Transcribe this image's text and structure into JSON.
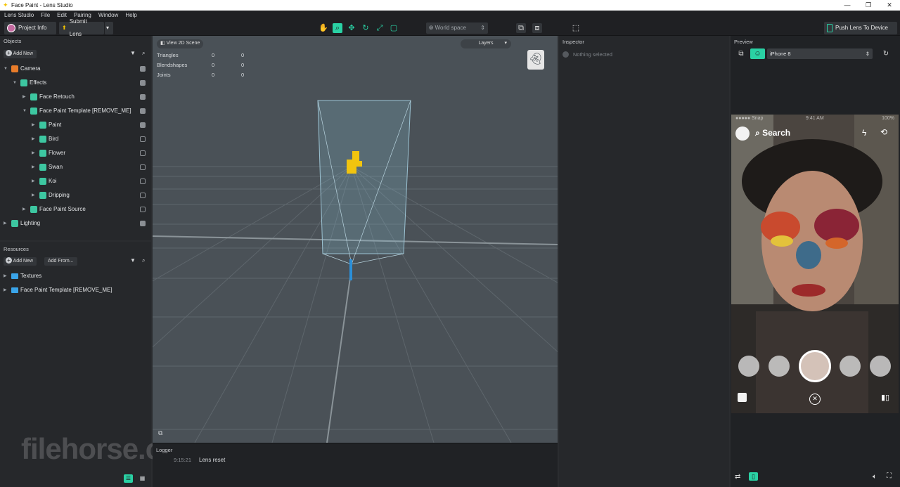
{
  "window": {
    "title": "Face Paint - Lens Studio"
  },
  "menu": [
    "Lens Studio",
    "File",
    "Edit",
    "Pairing",
    "Window",
    "Help"
  ],
  "toolbar": {
    "project_info": "Project Info",
    "submit_lens": "Submit Lens",
    "world_space": "World space",
    "push_lens": "Push Lens To Device"
  },
  "objects": {
    "header": "Objects",
    "add_new": "Add New",
    "items": [
      {
        "label": "Camera",
        "checked": true
      },
      {
        "label": "Effects",
        "checked": true
      },
      {
        "label": "Face Retouch",
        "checked": true
      },
      {
        "label": "Face Paint Template [REMOVE_ME]",
        "checked": true
      },
      {
        "label": "Paint",
        "checked": true
      },
      {
        "label": "Bird",
        "checked": false
      },
      {
        "label": "Flower",
        "checked": false
      },
      {
        "label": "Swan",
        "checked": false
      },
      {
        "label": "Koi",
        "checked": false
      },
      {
        "label": "Dripping",
        "checked": false
      },
      {
        "label": "Face Paint Source",
        "checked": false
      },
      {
        "label": "Lighting",
        "checked": true
      }
    ]
  },
  "resources": {
    "header": "Resources",
    "add_new": "Add New",
    "add_from": "Add From...",
    "items": [
      {
        "label": "Textures"
      },
      {
        "label": "Face Paint Template [REMOVE_ME]"
      }
    ]
  },
  "viewport": {
    "view_2d": "View 2D Scene",
    "layers": "Layers",
    "stats": [
      {
        "label": "Triangles",
        "a": "0",
        "b": "0"
      },
      {
        "label": "Blendshapes",
        "a": "0",
        "b": "0"
      },
      {
        "label": "Joints",
        "a": "0",
        "b": "0"
      }
    ]
  },
  "logger": {
    "header": "Logger",
    "time": "9:15:21",
    "message": "Lens reset"
  },
  "inspector": {
    "header": "Inspector",
    "empty": "Nothing selected"
  },
  "preview": {
    "header": "Preview",
    "device": "iPhone 8",
    "status_left": "●●●●● Snap",
    "status_time": "9:41 AM",
    "status_right": "100%",
    "search": "Search"
  },
  "watermark": "filehorse.com",
  "colors": {
    "accent": "#2ad1a4",
    "panel": "#26282b",
    "viewport": "#4a5157"
  }
}
